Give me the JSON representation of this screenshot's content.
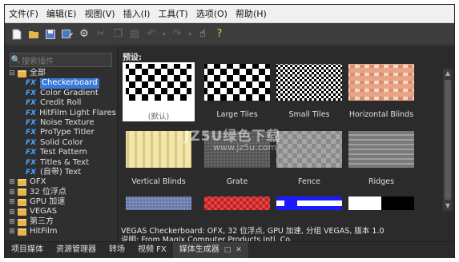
{
  "menu": [
    "文件(F)",
    "编辑(E)",
    "视图(V)",
    "插入(I)",
    "工具(T)",
    "选项(O)",
    "帮助(H)"
  ],
  "toolbar_icons": [
    "new-icon",
    "open-icon",
    "save-icon",
    "save-as-icon",
    "settings-icon",
    "cut-icon",
    "copy-icon",
    "paste-icon",
    "undo-icon",
    "undo-dropdown-icon",
    "redo-icon",
    "redo-dropdown-icon",
    "whats-this-icon",
    "help-icon"
  ],
  "search": {
    "placeholder": "搜索插件"
  },
  "tree": {
    "root": "全部",
    "fx_badge": "FX",
    "fx_items": [
      "Checkerboard",
      "Color Gradient",
      "Credit Roll",
      "HitFilm Light Flares",
      "Noise Texture",
      "ProType Titler",
      "Solid Color",
      "Test Pattern",
      "Titles & Text",
      "(自带) Text"
    ],
    "selected": "Checkerboard",
    "folders": [
      "OFX",
      "32 位浮点",
      "GPU 加速",
      "VEGAS",
      "第三方",
      "HitFilm"
    ]
  },
  "presets": {
    "title": "预设:",
    "items": [
      {
        "label": "(默认)"
      },
      {
        "label": "Large Tiles"
      },
      {
        "label": "Small Tiles"
      },
      {
        "label": "Horizontal Blinds"
      },
      {
        "label": "Vertical Blinds"
      },
      {
        "label": "Grate"
      },
      {
        "label": "Fence"
      },
      {
        "label": "Ridges"
      }
    ]
  },
  "description": {
    "line1": "VEGAS Checkerboard: OFX, 32 位浮点, GPU 加速, 分组 VEGAS, 版本 1.0",
    "line2": "说明: From Magix Computer Products Intl. Co."
  },
  "tabs": [
    "项目媒体",
    "资源管理器",
    "转场",
    "视频 FX",
    "媒体生成器"
  ],
  "active_tab": "媒体生成器",
  "watermark": {
    "line1": "JZ5U绿色下载",
    "line2": "www.jz5u.com"
  },
  "colors": {
    "accent": "#3b79d8",
    "fx": "#4aa3ff",
    "folder": "#e7b64a",
    "panel": "#2b2b2b"
  }
}
